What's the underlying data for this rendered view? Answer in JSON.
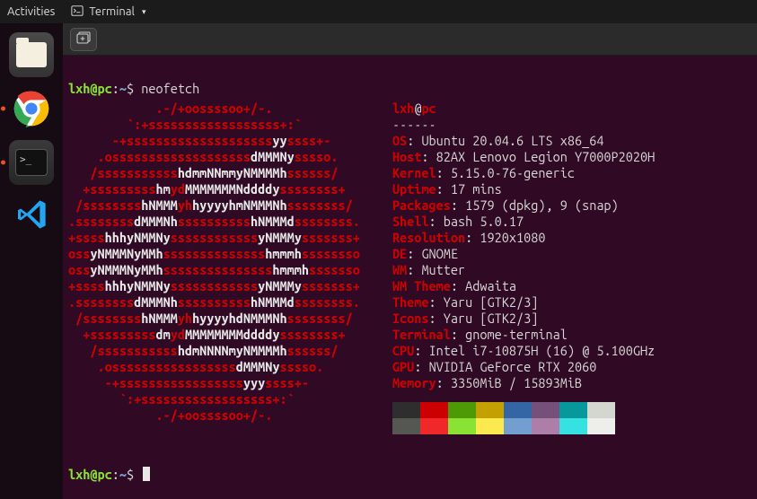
{
  "topbar": {
    "activities": "Activities",
    "appmenu": "Terminal"
  },
  "dock": {
    "items": [
      {
        "name": "files",
        "running": false
      },
      {
        "name": "chrome",
        "running": true
      },
      {
        "name": "terminal",
        "running": true,
        "active": true
      },
      {
        "name": "vscode",
        "running": false
      }
    ]
  },
  "prompt": {
    "user": "lxh",
    "host": "pc",
    "path": "~",
    "command": "neofetch"
  },
  "logo_lines": [
    [
      [
        "r",
        "            .-/+oossssoo+/-.            "
      ]
    ],
    [
      [
        "r",
        "        `:+ssssssssssssssssss+:`        "
      ]
    ],
    [
      [
        "r",
        "      -+ssssssssssssssssssss"
      ],
      [
        "w",
        "yy"
      ],
      [
        "r",
        "ssss+-     "
      ]
    ],
    [
      [
        "r",
        "    .osssssssssssssssssss"
      ],
      [
        "w",
        "dMMMNy"
      ],
      [
        "r",
        "sssso.   "
      ]
    ],
    [
      [
        "r",
        "   /sssssssssss"
      ],
      [
        "w",
        "hdmmNNmmyNMMMMh"
      ],
      [
        "r",
        "ssssss/   "
      ]
    ],
    [
      [
        "r",
        "  +sssssssss"
      ],
      [
        "w",
        "hm"
      ],
      [
        "r",
        "yd"
      ],
      [
        "w",
        "MMMMMMMNddddy"
      ],
      [
        "r",
        "ssssssss+  "
      ]
    ],
    [
      [
        "r",
        " /ssssssss"
      ],
      [
        "w",
        "hNMMM"
      ],
      [
        "r",
        "yh"
      ],
      [
        "w",
        "hyyyyhmNMMMNh"
      ],
      [
        "r",
        "ssssssss/ "
      ]
    ],
    [
      [
        "r",
        ".ssssssss"
      ],
      [
        "w",
        "dMMMNh"
      ],
      [
        "r",
        "ssssssssss"
      ],
      [
        "w",
        "hNMMMd"
      ],
      [
        "r",
        "ssssssss."
      ]
    ],
    [
      [
        "r",
        "+ssss"
      ],
      [
        "w",
        "hhhyNMMNy"
      ],
      [
        "r",
        "ssssssssssss"
      ],
      [
        "w",
        "yNMMMy"
      ],
      [
        "r",
        "sssssss+"
      ]
    ],
    [
      [
        "r",
        "oss"
      ],
      [
        "w",
        "yNMMMNyMMh"
      ],
      [
        "r",
        "ssssssssssssss"
      ],
      [
        "w",
        "hmmmh"
      ],
      [
        "r",
        "ssssssso"
      ]
    ],
    [
      [
        "r",
        "oss"
      ],
      [
        "w",
        "yNMMMNyMMh"
      ],
      [
        "r",
        "sssssssssssssss"
      ],
      [
        "w",
        "hmmmh"
      ],
      [
        "r",
        "sssssso"
      ]
    ],
    [
      [
        "r",
        "+ssss"
      ],
      [
        "w",
        "hhhyNMMNy"
      ],
      [
        "r",
        "ssssssssssss"
      ],
      [
        "w",
        "yNMMMy"
      ],
      [
        "r",
        "sssssss+"
      ]
    ],
    [
      [
        "r",
        ".ssssssss"
      ],
      [
        "w",
        "dMMMNh"
      ],
      [
        "r",
        "ssssssssss"
      ],
      [
        "w",
        "hNMMMd"
      ],
      [
        "r",
        "ssssssss."
      ]
    ],
    [
      [
        "r",
        " /ssssssss"
      ],
      [
        "w",
        "hNMMM"
      ],
      [
        "r",
        "yh"
      ],
      [
        "w",
        "hyyyyhdNMMMNh"
      ],
      [
        "r",
        "ssssssss/ "
      ]
    ],
    [
      [
        "r",
        "  +sssssssss"
      ],
      [
        "w",
        "dm"
      ],
      [
        "r",
        "yd"
      ],
      [
        "w",
        "MMMMMMMMddddy"
      ],
      [
        "r",
        "ssssssss+  "
      ]
    ],
    [
      [
        "r",
        "   /sssssssssss"
      ],
      [
        "w",
        "hdmNNNNmyNMMMMh"
      ],
      [
        "r",
        "ssssss/   "
      ]
    ],
    [
      [
        "r",
        "    .osssssssssssssssss"
      ],
      [
        "w",
        "dMMMNy"
      ],
      [
        "r",
        "sssso.     "
      ]
    ],
    [
      [
        "r",
        "     -+sssssssssssssssss"
      ],
      [
        "w",
        "yyy"
      ],
      [
        "r",
        "ssss+-      "
      ]
    ],
    [
      [
        "r",
        "       `:+ssssssssssssssssss+:`         "
      ]
    ],
    [
      [
        "r",
        "            .-/+oossssoo+/-.            "
      ]
    ]
  ],
  "info": {
    "user": "lxh",
    "host": "pc",
    "dashes": "------",
    "fields": [
      {
        "key": "OS",
        "val": "Ubuntu 20.04.6 LTS x86_64"
      },
      {
        "key": "Host",
        "val": "82AX Lenovo Legion Y7000P2020H"
      },
      {
        "key": "Kernel",
        "val": "5.15.0-76-generic"
      },
      {
        "key": "Uptime",
        "val": "17 mins"
      },
      {
        "key": "Packages",
        "val": "1579 (dpkg), 9 (snap)"
      },
      {
        "key": "Shell",
        "val": "bash 5.0.17"
      },
      {
        "key": "Resolution",
        "val": "1920x1080"
      },
      {
        "key": "DE",
        "val": "GNOME"
      },
      {
        "key": "WM",
        "val": "Mutter"
      },
      {
        "key": "WM Theme",
        "val": "Adwaita"
      },
      {
        "key": "Theme",
        "val": "Yaru [GTK2/3]"
      },
      {
        "key": "Icons",
        "val": "Yaru [GTK2/3]"
      },
      {
        "key": "Terminal",
        "val": "gnome-terminal"
      },
      {
        "key": "CPU",
        "val": "Intel i7-10875H (16) @ 5.100GHz"
      },
      {
        "key": "GPU",
        "val": "NVIDIA GeForce RTX 2060"
      },
      {
        "key": "Memory",
        "val": "3350MiB / 15893MiB"
      }
    ]
  },
  "palette": [
    "#2e2e2e",
    "#cc0000",
    "#4e9a06",
    "#c4a000",
    "#3465a4",
    "#75507b",
    "#06989a",
    "#d3d7cf",
    "#555753",
    "#ef2929",
    "#8ae234",
    "#fce94f",
    "#729fcf",
    "#ad7fa8",
    "#34e2e2",
    "#eeeeec"
  ]
}
